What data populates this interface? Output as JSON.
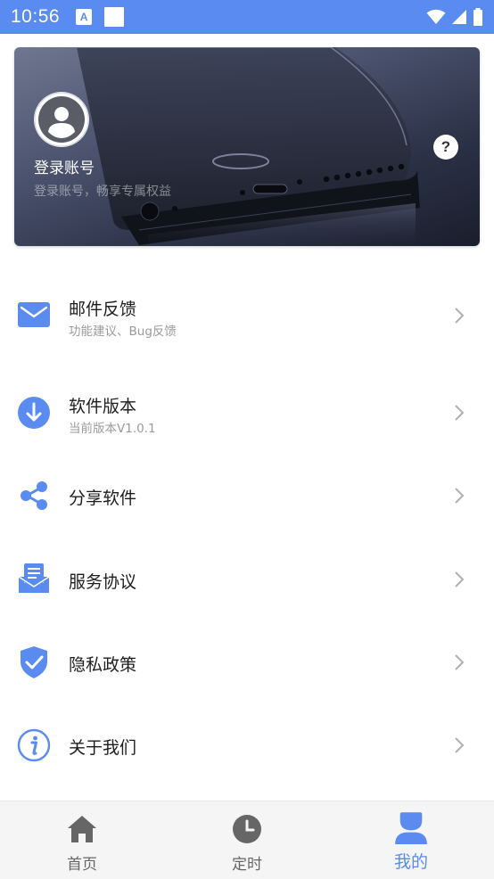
{
  "status_bar": {
    "time": "10:56",
    "app_icon_letter": "A"
  },
  "profile": {
    "title": "登录账号",
    "subtitle": "登录账号，畅享专属权益",
    "help_symbol": "?"
  },
  "menu": [
    {
      "title": "邮件反馈",
      "subtitle": "功能建议、Bug反馈",
      "icon": "mail-icon"
    },
    {
      "title": "软件版本",
      "subtitle": "当前版本V1.0.1",
      "icon": "download-icon"
    },
    {
      "title": "分享软件",
      "subtitle": "",
      "icon": "share-icon"
    },
    {
      "title": "服务协议",
      "subtitle": "",
      "icon": "document-icon"
    },
    {
      "title": "隐私政策",
      "subtitle": "",
      "icon": "shield-icon"
    },
    {
      "title": "关于我们",
      "subtitle": "",
      "icon": "info-icon"
    }
  ],
  "bottom_nav": [
    {
      "label": "首页",
      "icon": "home-icon",
      "active": false
    },
    {
      "label": "定时",
      "icon": "clock-icon",
      "active": false
    },
    {
      "label": "我的",
      "icon": "person-icon",
      "active": true
    }
  ],
  "colors": {
    "accent": "#5a8bf0",
    "nav_inactive": "#666666",
    "status_bar": "#5a8bf0"
  }
}
